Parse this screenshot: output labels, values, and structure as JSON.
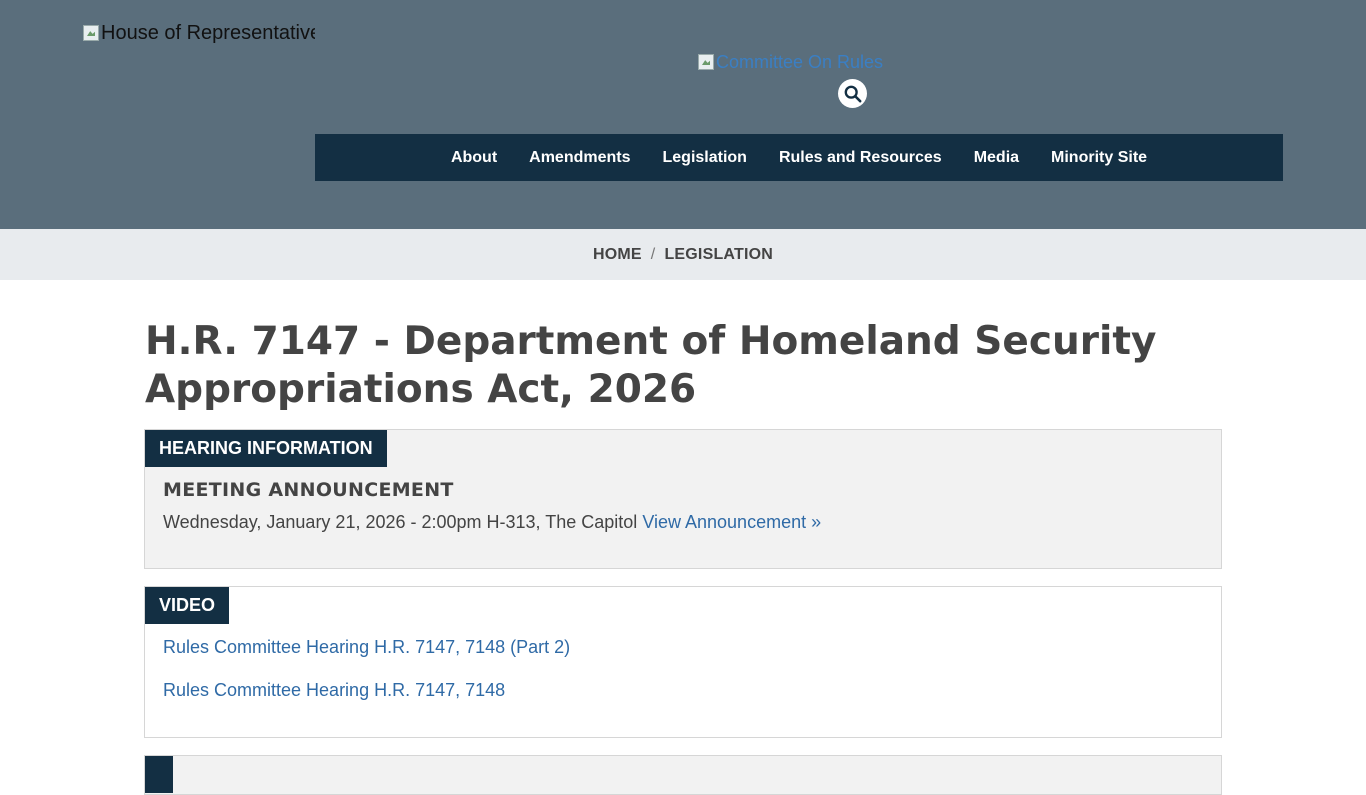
{
  "header": {
    "house_logo_alt": "House of Representatives",
    "committee_logo_alt": "Committee On Rules",
    "search_icon": "search-icon"
  },
  "nav": {
    "items": [
      "About",
      "Amendments",
      "Legislation",
      "Rules and Resources",
      "Media",
      "Minority Site"
    ]
  },
  "breadcrumb": {
    "home": "HOME",
    "separator": "/",
    "current": "LEGISLATION"
  },
  "page": {
    "title": "H.R. 7147 - Department of Homeland Security Appropriations Act, 2026"
  },
  "hearing": {
    "tag": "HEARING INFORMATION",
    "heading": "MEETING ANNOUNCEMENT",
    "details": "Wednesday, January 21, 2026 - 2:00pm H-313, The Capitol",
    "link": "View Announcement »"
  },
  "video": {
    "tag": "VIDEO",
    "links": [
      "Rules Committee Hearing H.R. 7147, 7148 (Part 2)",
      "Rules Committee Hearing H.R. 7147, 7148"
    ]
  },
  "colors": {
    "header_bg": "#5a6e7c",
    "nav_bg": "#132f43",
    "breadcrumb_bg": "#e8ebee",
    "link": "#2f6aa6"
  }
}
